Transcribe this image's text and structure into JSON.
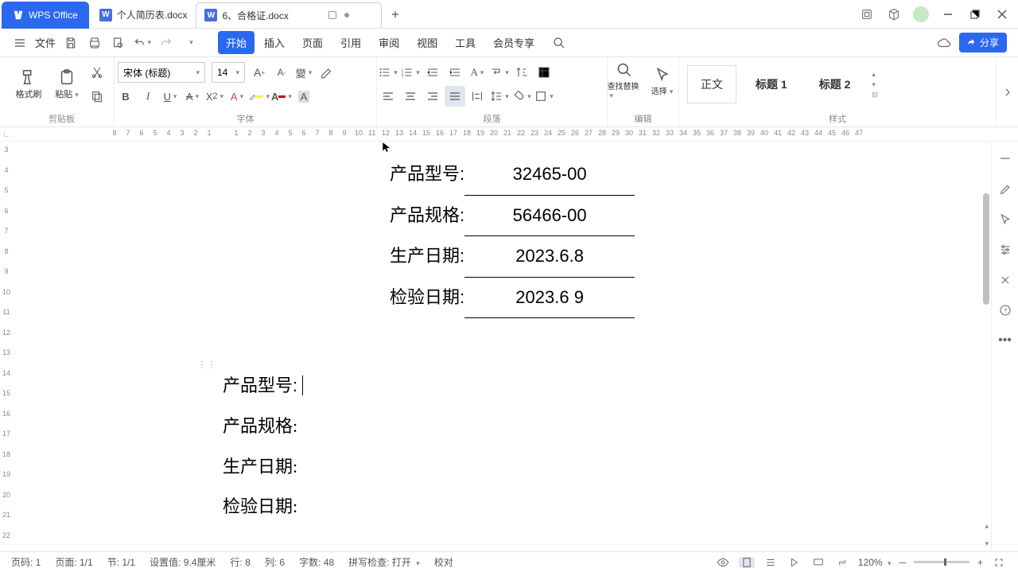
{
  "app": {
    "name": "WPS Office"
  },
  "tabs": {
    "doc1": "个人简历表.docx",
    "doc2": "6、合格证.docx"
  },
  "menu": {
    "file": "文件",
    "start": "开始",
    "insert": "插入",
    "page": "页面",
    "ref": "引用",
    "review": "审阅",
    "view": "视图",
    "tool": "工具",
    "vip": "会员专享",
    "share": "分享"
  },
  "ribbon": {
    "format_brush": "格式刷",
    "paste": "粘贴",
    "clipboard_label": "剪贴板",
    "font_name": "宋体 (标题)",
    "font_size": "14",
    "font_label": "字体",
    "para_label": "段落",
    "find_replace": "查找替换",
    "select": "选择",
    "edit_label": "编辑",
    "style_body": "正文",
    "style_h1": "标题 1",
    "style_h2": "标题 2",
    "styles_label": "样式"
  },
  "document": {
    "group1": {
      "r1_label": "产品型号:",
      "r1_value": "32465-00",
      "r2_label": "产品规格:",
      "r2_value": "56466-00",
      "r3_label": "生产日期:",
      "r3_value": "2023.6.8",
      "r4_label": "检验日期:",
      "r4_value": "2023.6 9"
    },
    "group2": {
      "r1": "产品型号:",
      "r2": "产品规格:",
      "r3": "生产日期:",
      "r4": "检验日期:"
    }
  },
  "status": {
    "page_no": "页码: 1",
    "page": "页面: 1/1",
    "section": "节: 1/1",
    "pos": "设置值: 9.4厘米",
    "row": "行: 8",
    "col": "列: 6",
    "words": "字数: 48",
    "spell": "拼写检查: 打开",
    "proof": "校对",
    "zoom": "120%"
  },
  "rulers": {
    "h_neg": [
      "8",
      "7",
      "6",
      "5",
      "4",
      "3",
      "2",
      "1"
    ],
    "h_pos": [
      "1",
      "2",
      "3",
      "4",
      "5",
      "6",
      "7",
      "8",
      "9",
      "10",
      "11",
      "12",
      "13",
      "14",
      "15",
      "16",
      "17",
      "18",
      "19",
      "20",
      "21",
      "22",
      "23",
      "24",
      "25",
      "26",
      "27",
      "28",
      "29",
      "30",
      "31",
      "32",
      "33",
      "34",
      "35",
      "36",
      "37",
      "38",
      "39",
      "40",
      "41",
      "42",
      "43",
      "44",
      "45",
      "46",
      "47"
    ],
    "v": [
      "3",
      "4",
      "5",
      "6",
      "7",
      "8",
      "9",
      "10",
      "11",
      "12",
      "13",
      "14",
      "15",
      "16",
      "17",
      "18",
      "19",
      "20",
      "21",
      "22"
    ]
  }
}
